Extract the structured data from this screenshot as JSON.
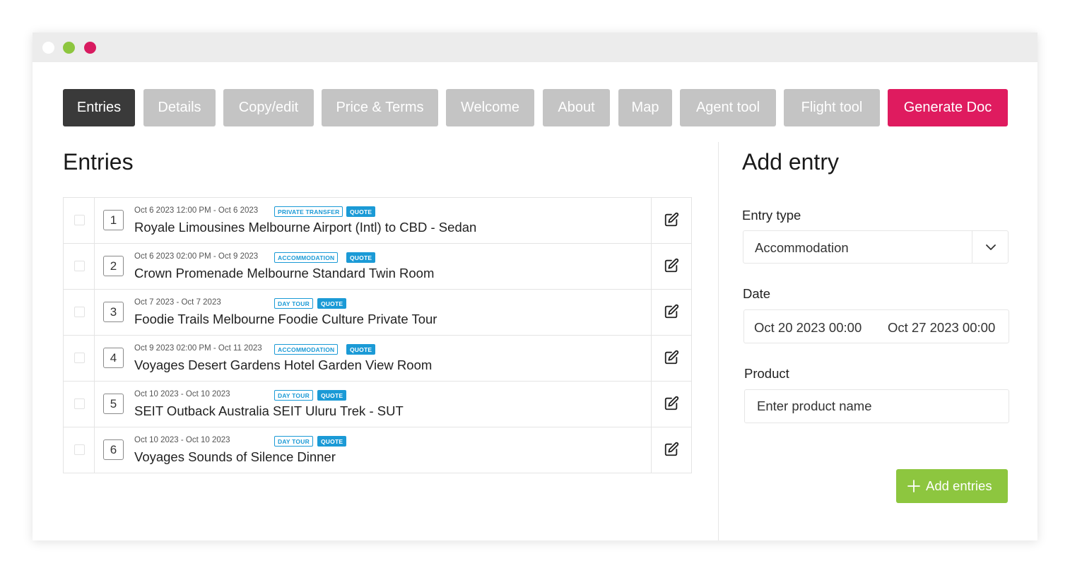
{
  "tabs": [
    {
      "label": "Entries",
      "state": "active"
    },
    {
      "label": "Details"
    },
    {
      "label": "Copy/edit"
    },
    {
      "label": "Price & Terms"
    },
    {
      "label": "Welcome"
    },
    {
      "label": "About"
    },
    {
      "label": "Map"
    },
    {
      "label": "Agent tool"
    },
    {
      "label": "Flight tool"
    },
    {
      "label": "Generate Doc",
      "state": "primary"
    }
  ],
  "entries": {
    "title": "Entries",
    "rows": [
      {
        "num": "1",
        "date": "Oct 6 2023 12:00 PM - Oct 6 2023",
        "type": "PRIVATE TRANSFER",
        "status": "QUOTE",
        "name": "Royale Limousines Melbourne Airport (Intl) to CBD - Sedan"
      },
      {
        "num": "2",
        "date": "Oct 6 2023 02:00 PM - Oct 9 2023",
        "type": "ACCOMMODATION",
        "status": "QUOTE",
        "name": "Crown Promenade Melbourne Standard Twin Room"
      },
      {
        "num": "3",
        "date": "Oct 7 2023 - Oct 7 2023",
        "type": "DAY TOUR",
        "status": "QUOTE",
        "name": "Foodie Trails Melbourne Foodie Culture Private Tour"
      },
      {
        "num": "4",
        "date": "Oct 9 2023 02:00 PM - Oct 11 2023",
        "type": "ACCOMMODATION",
        "status": "QUOTE",
        "name": "Voyages Desert Gardens Hotel Garden View Room"
      },
      {
        "num": "5",
        "date": "Oct 10 2023 - Oct 10 2023",
        "type": "DAY TOUR",
        "status": "QUOTE",
        "name": "SEIT Outback Australia SEIT Uluru Trek - SUT"
      },
      {
        "num": "6",
        "date": "Oct 10 2023 - Oct 10 2023",
        "type": "DAY TOUR",
        "status": "QUOTE",
        "name": "Voyages Sounds of Silence Dinner"
      }
    ]
  },
  "add_entry": {
    "title": "Add entry",
    "entry_type_label": "Entry type",
    "entry_type_value": "Accommodation",
    "date_label": "Date",
    "date_start": "Oct 20 2023 00:00",
    "date_end": "Oct 27 2023 00:00",
    "product_label": "Product",
    "product_placeholder": "Enter product name",
    "add_button_label": "Add entries"
  },
  "colors": {
    "active_tab": "#3a3a3a",
    "inactive_tab": "#c4c4c4",
    "primary": "#df1b5f",
    "badge": "#1b9ad6",
    "add_button": "#8dc63f"
  },
  "icons": {
    "edit": "edit-icon",
    "chevron": "chevron-down-icon",
    "plus": "plus-icon"
  }
}
